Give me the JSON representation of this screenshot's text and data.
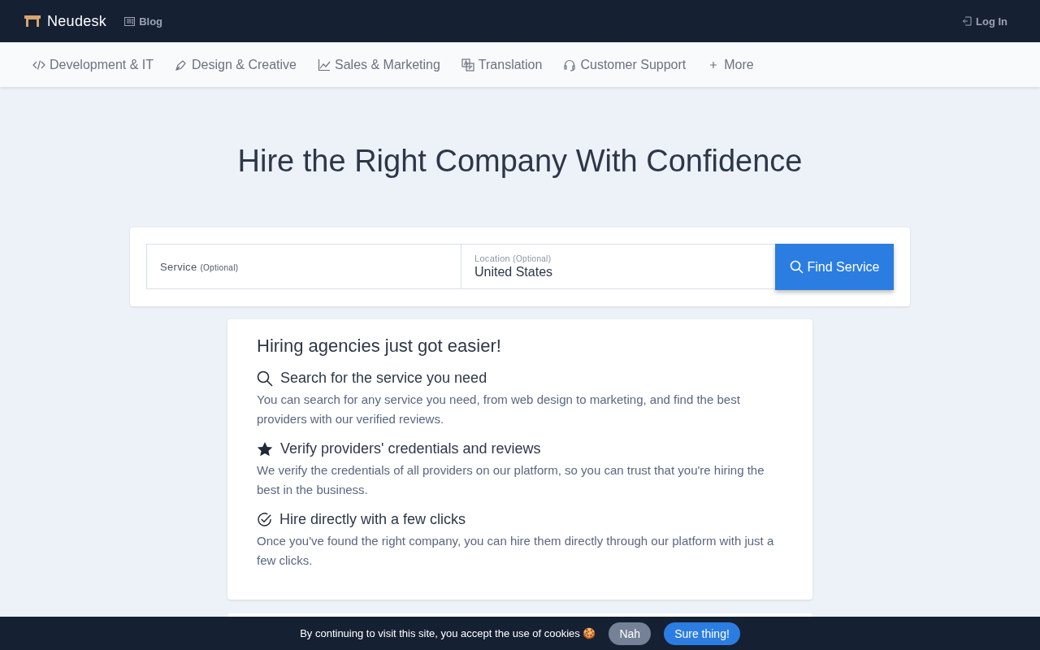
{
  "header": {
    "brand": "Neudesk",
    "links": [
      {
        "label": "Blog",
        "kind": "blog"
      }
    ],
    "login": "Log In"
  },
  "categories": [
    {
      "label": "Development & IT",
      "kind": "code"
    },
    {
      "label": "Design & Creative",
      "kind": "pen"
    },
    {
      "label": "Sales & Marketing",
      "kind": "chart"
    },
    {
      "label": "Translation",
      "kind": "translate"
    },
    {
      "label": "Customer Support",
      "kind": "headset"
    },
    {
      "label": "More",
      "kind": "plus"
    }
  ],
  "hero": {
    "title": "Hire the Right Company With Confidence"
  },
  "search": {
    "fields": [
      {
        "label": "Service",
        "note": "(Optional)"
      },
      {
        "label": "Location",
        "note": "(Optional)",
        "value": "United States"
      }
    ],
    "button": "Find Service"
  },
  "info": {
    "title": "Hiring agencies just got easier!",
    "items": [
      {
        "kind": "search",
        "title": "Search for the service you need",
        "text": "You can search for any service you need, from web design to marketing, and find the best providers with our verified reviews."
      },
      {
        "kind": "star",
        "title": "Verify providers' credentials and reviews",
        "text": "We verify the credentials of all providers on our platform, so you can trust that you're hiring the best in the business."
      },
      {
        "kind": "check",
        "title": "Hire directly with a few clicks",
        "text": "Once you've found the right company, you can hire them directly through our platform with just a few clicks."
      }
    ]
  },
  "cookie_bar": {
    "text": "By continuing to visit this site, you accept the use of cookies 🍪",
    "decline": "Nah",
    "accept": "Sure thing!"
  }
}
